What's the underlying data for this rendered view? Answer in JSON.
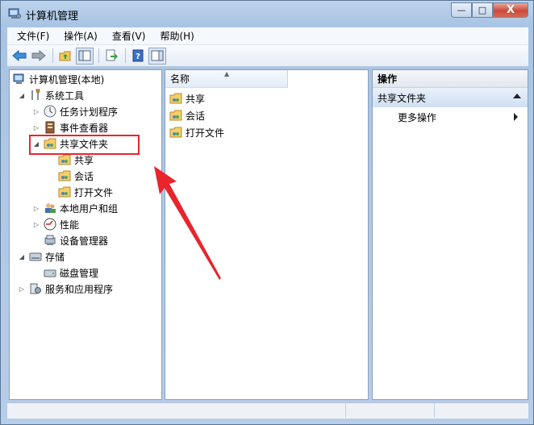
{
  "window": {
    "title": "计算机管理",
    "min_label": "—",
    "max_label": "□",
    "close_label": "X"
  },
  "menu": {
    "items": [
      "文件(F)",
      "操作(A)",
      "查看(V)",
      "帮助(H)"
    ]
  },
  "toolbar": {
    "buttons": [
      "back-icon",
      "forward-icon",
      "up-folder-icon",
      "show-hide-tree-icon",
      "export-list-icon",
      "help-icon",
      "show-hide-action-pane-icon"
    ]
  },
  "tree": {
    "root": "计算机管理(本地)",
    "system_tools": "系统工具",
    "task_scheduler": "任务计划程序",
    "event_viewer": "事件查看器",
    "shared_folders": "共享文件夹",
    "shares": "共享",
    "sessions": "会话",
    "open_files": "打开文件",
    "local_users": "本地用户和组",
    "performance": "性能",
    "device_manager": "设备管理器",
    "storage": "存储",
    "disk_management": "磁盘管理",
    "services_apps": "服务和应用程序"
  },
  "list": {
    "column_name": "名称",
    "items": [
      "共享",
      "会话",
      "打开文件"
    ]
  },
  "actions": {
    "header": "操作",
    "section": "共享文件夹",
    "more_actions": "更多操作"
  },
  "colors": {
    "annotation_red": "#e8252c",
    "window_frame": "#bcd3ec"
  }
}
